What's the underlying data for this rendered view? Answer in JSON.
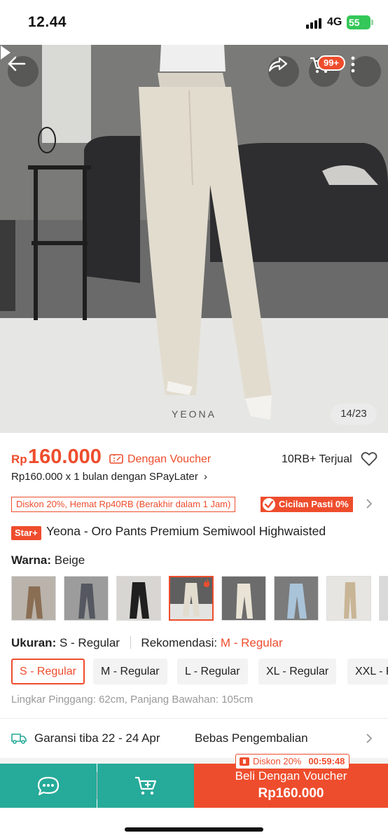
{
  "status_bar": {
    "time": "12.44",
    "network": "4G",
    "battery": "55"
  },
  "gallery": {
    "counter": "14/23",
    "watermark": "YEONA",
    "cart_badge": "99+"
  },
  "price": {
    "currency": "Rp",
    "amount": "160.000",
    "voucher_label": "Dengan Voucher",
    "sold": "10RB+ Terjual",
    "paylater": "Rp160.000 x 1 bulan dengan SPayLater"
  },
  "promos": {
    "discount": "Diskon 20%, Hemat Rp40RB (Berakhir dalam 1 Jam)",
    "installment": "Cicilan Pasti 0%"
  },
  "product": {
    "badge": "Star+",
    "title": "Yeona - Oro Pants Premium Semiwool Highwaisted"
  },
  "color": {
    "label": "Warna:",
    "value": "Beige"
  },
  "size": {
    "label": "Ukuran:",
    "value": "S - Regular",
    "rec_label": "Rekomendasi:",
    "rec_value": "M - Regular",
    "options": [
      "S - Regular",
      "M - Regular",
      "L - Regular",
      "XL - Regular",
      "XXL - Regular"
    ],
    "measurement": "Lingkar Pinggang: 62cm, Panjang Bawahan: 105cm"
  },
  "shipping": {
    "guarantee": "Garansi tiba 22 - 24 Apr",
    "returns": "Bebas Pengembalian"
  },
  "bottom_bar": {
    "buy_label": "Beli Dengan Voucher",
    "buy_price": "Rp160.000",
    "discount_tag": "Diskon 20%",
    "timer": "00:59:48"
  },
  "colors": {
    "accent": "#ee4d2d",
    "teal": "#26aa99"
  }
}
